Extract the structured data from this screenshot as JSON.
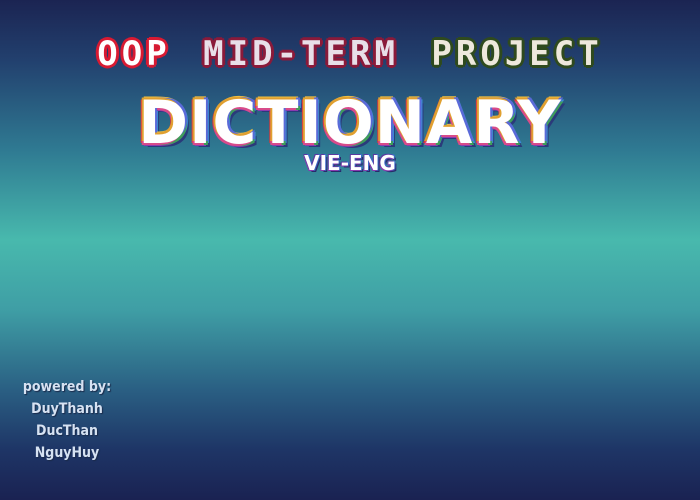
{
  "header": {
    "words": [
      "OOP",
      "MID-TERM",
      "PROJECT"
    ]
  },
  "title": "DICTIONARY",
  "subtitle": "VIE-ENG",
  "credits": {
    "label": "powered by:",
    "names": [
      "DuyThanh",
      "DucThan",
      "NguyHuy"
    ]
  },
  "colors": {
    "background_top": "#1b2452",
    "background_mid": "#48b9ad",
    "background_bottom": "#1a2252",
    "header_word_1_outline": "#d81a32",
    "header_word_2_outline": "#8a1a3a",
    "header_word_3_outline": "#2f4a1e"
  }
}
